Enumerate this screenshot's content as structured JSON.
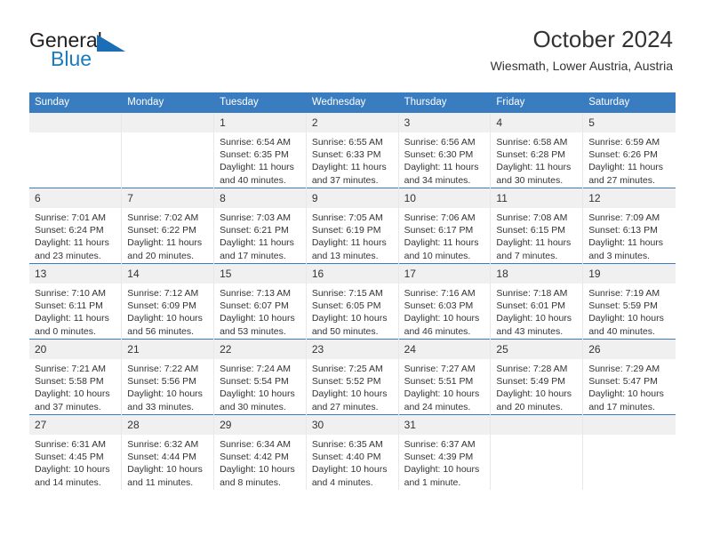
{
  "brand": {
    "name_top": "General",
    "name_bottom": "Blue",
    "triangle_color": "#1b6db5",
    "blue_color": "#1b7bbd"
  },
  "header": {
    "title": "October 2024",
    "subtitle": "Wiesmath, Lower Austria, Austria"
  },
  "theme": {
    "header_bg": "#3a7cc0",
    "daynum_bg": "#f0f0f0",
    "text": "#333333"
  },
  "weekday_headers": [
    "Sunday",
    "Monday",
    "Tuesday",
    "Wednesday",
    "Thursday",
    "Friday",
    "Saturday"
  ],
  "labels": {
    "sunrise_prefix": "Sunrise:",
    "sunset_prefix": "Sunset:",
    "daylight_prefix": "Daylight:"
  },
  "weeks": [
    [
      {
        "day": "",
        "empty": true
      },
      {
        "day": "",
        "empty": true
      },
      {
        "day": "1",
        "sunrise": "Sunrise: 6:54 AM",
        "sunset": "Sunset: 6:35 PM",
        "daylight": "Daylight: 11 hours and 40 minutes."
      },
      {
        "day": "2",
        "sunrise": "Sunrise: 6:55 AM",
        "sunset": "Sunset: 6:33 PM",
        "daylight": "Daylight: 11 hours and 37 minutes."
      },
      {
        "day": "3",
        "sunrise": "Sunrise: 6:56 AM",
        "sunset": "Sunset: 6:30 PM",
        "daylight": "Daylight: 11 hours and 34 minutes."
      },
      {
        "day": "4",
        "sunrise": "Sunrise: 6:58 AM",
        "sunset": "Sunset: 6:28 PM",
        "daylight": "Daylight: 11 hours and 30 minutes."
      },
      {
        "day": "5",
        "sunrise": "Sunrise: 6:59 AM",
        "sunset": "Sunset: 6:26 PM",
        "daylight": "Daylight: 11 hours and 27 minutes."
      }
    ],
    [
      {
        "day": "6",
        "sunrise": "Sunrise: 7:01 AM",
        "sunset": "Sunset: 6:24 PM",
        "daylight": "Daylight: 11 hours and 23 minutes."
      },
      {
        "day": "7",
        "sunrise": "Sunrise: 7:02 AM",
        "sunset": "Sunset: 6:22 PM",
        "daylight": "Daylight: 11 hours and 20 minutes."
      },
      {
        "day": "8",
        "sunrise": "Sunrise: 7:03 AM",
        "sunset": "Sunset: 6:21 PM",
        "daylight": "Daylight: 11 hours and 17 minutes."
      },
      {
        "day": "9",
        "sunrise": "Sunrise: 7:05 AM",
        "sunset": "Sunset: 6:19 PM",
        "daylight": "Daylight: 11 hours and 13 minutes."
      },
      {
        "day": "10",
        "sunrise": "Sunrise: 7:06 AM",
        "sunset": "Sunset: 6:17 PM",
        "daylight": "Daylight: 11 hours and 10 minutes."
      },
      {
        "day": "11",
        "sunrise": "Sunrise: 7:08 AM",
        "sunset": "Sunset: 6:15 PM",
        "daylight": "Daylight: 11 hours and 7 minutes."
      },
      {
        "day": "12",
        "sunrise": "Sunrise: 7:09 AM",
        "sunset": "Sunset: 6:13 PM",
        "daylight": "Daylight: 11 hours and 3 minutes."
      }
    ],
    [
      {
        "day": "13",
        "sunrise": "Sunrise: 7:10 AM",
        "sunset": "Sunset: 6:11 PM",
        "daylight": "Daylight: 11 hours and 0 minutes."
      },
      {
        "day": "14",
        "sunrise": "Sunrise: 7:12 AM",
        "sunset": "Sunset: 6:09 PM",
        "daylight": "Daylight: 10 hours and 56 minutes."
      },
      {
        "day": "15",
        "sunrise": "Sunrise: 7:13 AM",
        "sunset": "Sunset: 6:07 PM",
        "daylight": "Daylight: 10 hours and 53 minutes."
      },
      {
        "day": "16",
        "sunrise": "Sunrise: 7:15 AM",
        "sunset": "Sunset: 6:05 PM",
        "daylight": "Daylight: 10 hours and 50 minutes."
      },
      {
        "day": "17",
        "sunrise": "Sunrise: 7:16 AM",
        "sunset": "Sunset: 6:03 PM",
        "daylight": "Daylight: 10 hours and 46 minutes."
      },
      {
        "day": "18",
        "sunrise": "Sunrise: 7:18 AM",
        "sunset": "Sunset: 6:01 PM",
        "daylight": "Daylight: 10 hours and 43 minutes."
      },
      {
        "day": "19",
        "sunrise": "Sunrise: 7:19 AM",
        "sunset": "Sunset: 5:59 PM",
        "daylight": "Daylight: 10 hours and 40 minutes."
      }
    ],
    [
      {
        "day": "20",
        "sunrise": "Sunrise: 7:21 AM",
        "sunset": "Sunset: 5:58 PM",
        "daylight": "Daylight: 10 hours and 37 minutes."
      },
      {
        "day": "21",
        "sunrise": "Sunrise: 7:22 AM",
        "sunset": "Sunset: 5:56 PM",
        "daylight": "Daylight: 10 hours and 33 minutes."
      },
      {
        "day": "22",
        "sunrise": "Sunrise: 7:24 AM",
        "sunset": "Sunset: 5:54 PM",
        "daylight": "Daylight: 10 hours and 30 minutes."
      },
      {
        "day": "23",
        "sunrise": "Sunrise: 7:25 AM",
        "sunset": "Sunset: 5:52 PM",
        "daylight": "Daylight: 10 hours and 27 minutes."
      },
      {
        "day": "24",
        "sunrise": "Sunrise: 7:27 AM",
        "sunset": "Sunset: 5:51 PM",
        "daylight": "Daylight: 10 hours and 24 minutes."
      },
      {
        "day": "25",
        "sunrise": "Sunrise: 7:28 AM",
        "sunset": "Sunset: 5:49 PM",
        "daylight": "Daylight: 10 hours and 20 minutes."
      },
      {
        "day": "26",
        "sunrise": "Sunrise: 7:29 AM",
        "sunset": "Sunset: 5:47 PM",
        "daylight": "Daylight: 10 hours and 17 minutes."
      }
    ],
    [
      {
        "day": "27",
        "sunrise": "Sunrise: 6:31 AM",
        "sunset": "Sunset: 4:45 PM",
        "daylight": "Daylight: 10 hours and 14 minutes."
      },
      {
        "day": "28",
        "sunrise": "Sunrise: 6:32 AM",
        "sunset": "Sunset: 4:44 PM",
        "daylight": "Daylight: 10 hours and 11 minutes."
      },
      {
        "day": "29",
        "sunrise": "Sunrise: 6:34 AM",
        "sunset": "Sunset: 4:42 PM",
        "daylight": "Daylight: 10 hours and 8 minutes."
      },
      {
        "day": "30",
        "sunrise": "Sunrise: 6:35 AM",
        "sunset": "Sunset: 4:40 PM",
        "daylight": "Daylight: 10 hours and 4 minutes."
      },
      {
        "day": "31",
        "sunrise": "Sunrise: 6:37 AM",
        "sunset": "Sunset: 4:39 PM",
        "daylight": "Daylight: 10 hours and 1 minute."
      },
      {
        "day": "",
        "empty": true
      },
      {
        "day": "",
        "empty": true
      }
    ]
  ]
}
